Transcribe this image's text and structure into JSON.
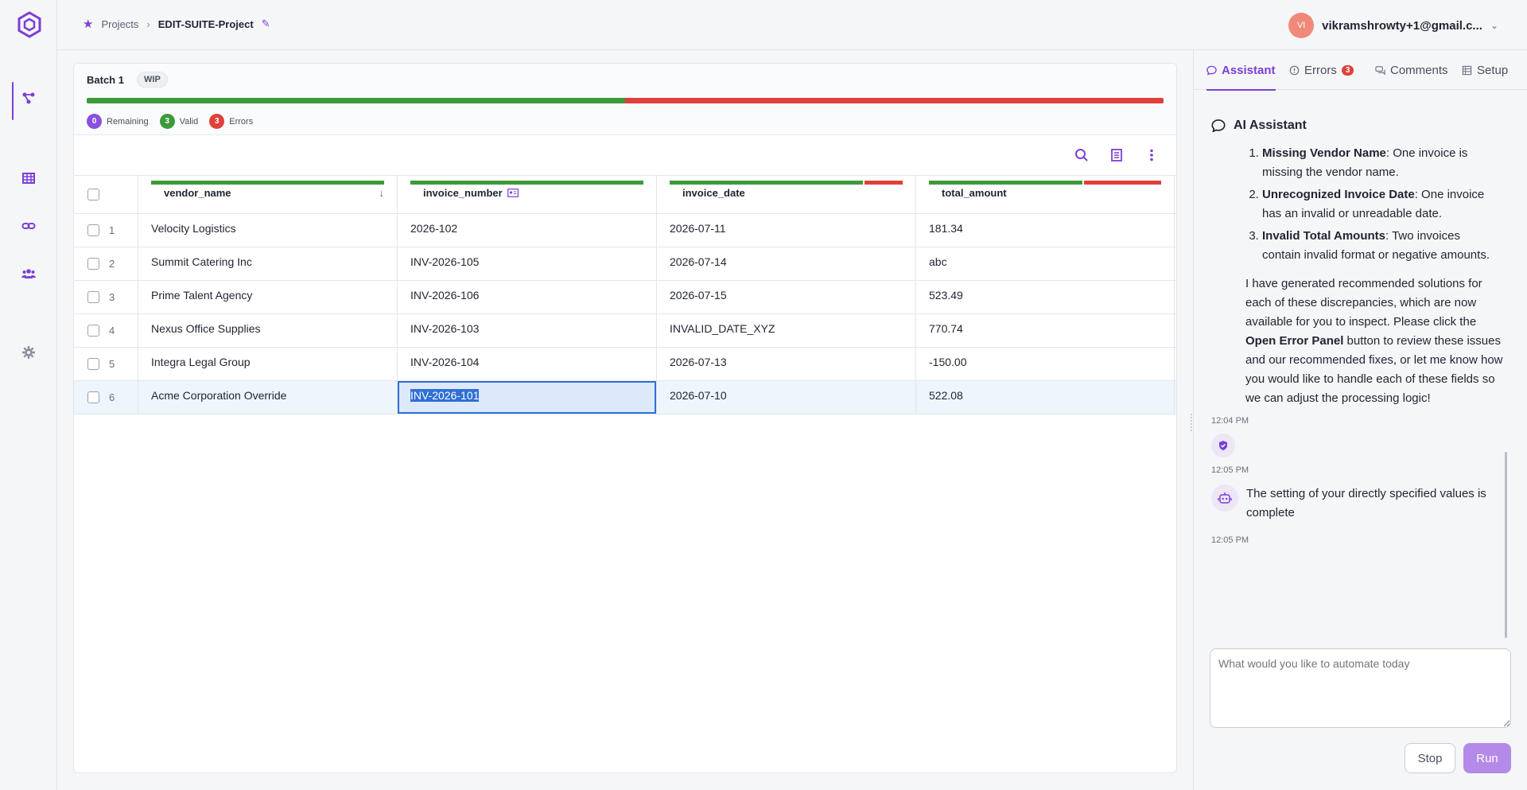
{
  "header": {
    "breadcrumb_root": "Projects",
    "breadcrumb_current": "EDIT-SUITE-Project",
    "user_initials": "VI",
    "user_email": "vikramshrowty+1@gmail.c..."
  },
  "batch": {
    "title": "Batch 1",
    "status": "WIP",
    "progress_valid_fraction": 0.5,
    "remaining_count": "0",
    "remaining_label": "Remaining",
    "valid_count": "3",
    "valid_label": "Valid",
    "errors_count": "3",
    "errors_label": "Errors"
  },
  "table": {
    "columns": [
      "vendor_name",
      "invoice_number",
      "invoice_date",
      "total_amount"
    ],
    "rows": [
      {
        "num": "1",
        "vendor_name": "Velocity Logistics",
        "invoice_number": "2026-102",
        "invoice_date": "2026-07-11",
        "total_amount": "181.34"
      },
      {
        "num": "2",
        "vendor_name": "Summit Catering Inc",
        "invoice_number": "INV-2026-105",
        "invoice_date": "2026-07-14",
        "total_amount": "abc"
      },
      {
        "num": "3",
        "vendor_name": "Prime Talent Agency",
        "invoice_number": "INV-2026-106",
        "invoice_date": "2026-07-15",
        "total_amount": "523.49"
      },
      {
        "num": "4",
        "vendor_name": "Nexus Office Supplies",
        "invoice_number": "INV-2026-103",
        "invoice_date": "INVALID_DATE_XYZ",
        "total_amount": "770.74"
      },
      {
        "num": "5",
        "vendor_name": "Integra Legal Group",
        "invoice_number": "INV-2026-104",
        "invoice_date": "2026-07-13",
        "total_amount": "-150.00"
      },
      {
        "num": "6",
        "vendor_name": "Acme Corporation Override",
        "invoice_number": "INV-2026-101",
        "invoice_date": "2026-07-10",
        "total_amount": "522.08"
      }
    ]
  },
  "panel": {
    "tabs": [
      {
        "label": "Assistant"
      },
      {
        "label": "Errors",
        "badge": "3"
      },
      {
        "label": "Comments"
      },
      {
        "label": "Setup"
      }
    ],
    "heading": "AI Assistant",
    "issues": [
      {
        "title": "Missing Vendor Name",
        "text": ": One invoice is missing the vendor name."
      },
      {
        "title": "Unrecognized Invoice Date",
        "text": ": One invoice has an invalid or unreadable date."
      },
      {
        "title": "Invalid Total Amounts",
        "text": ": Two invoices contain invalid format or negative amounts."
      }
    ],
    "para_before": "I have generated recommended solutions for each of these discrepancies, which are now available for you to inspect. Please click the ",
    "para_bold": "Open Error Panel",
    "para_after": " button to review these issues and our recommended fixes, or let me know how you would like to handle each of these fields so we can adjust the processing logic!",
    "ts1": "12:04 PM",
    "ts2": "12:05 PM",
    "bot_message": "The setting of your directly specified values is complete",
    "ts3": "12:05 PM",
    "input_placeholder": "What would you like to automate today",
    "stop_label": "Stop",
    "run_label": "Run"
  },
  "colors": {
    "accent": "#7b3fd6",
    "valid": "#3c9a3a",
    "error": "#e0403b"
  }
}
